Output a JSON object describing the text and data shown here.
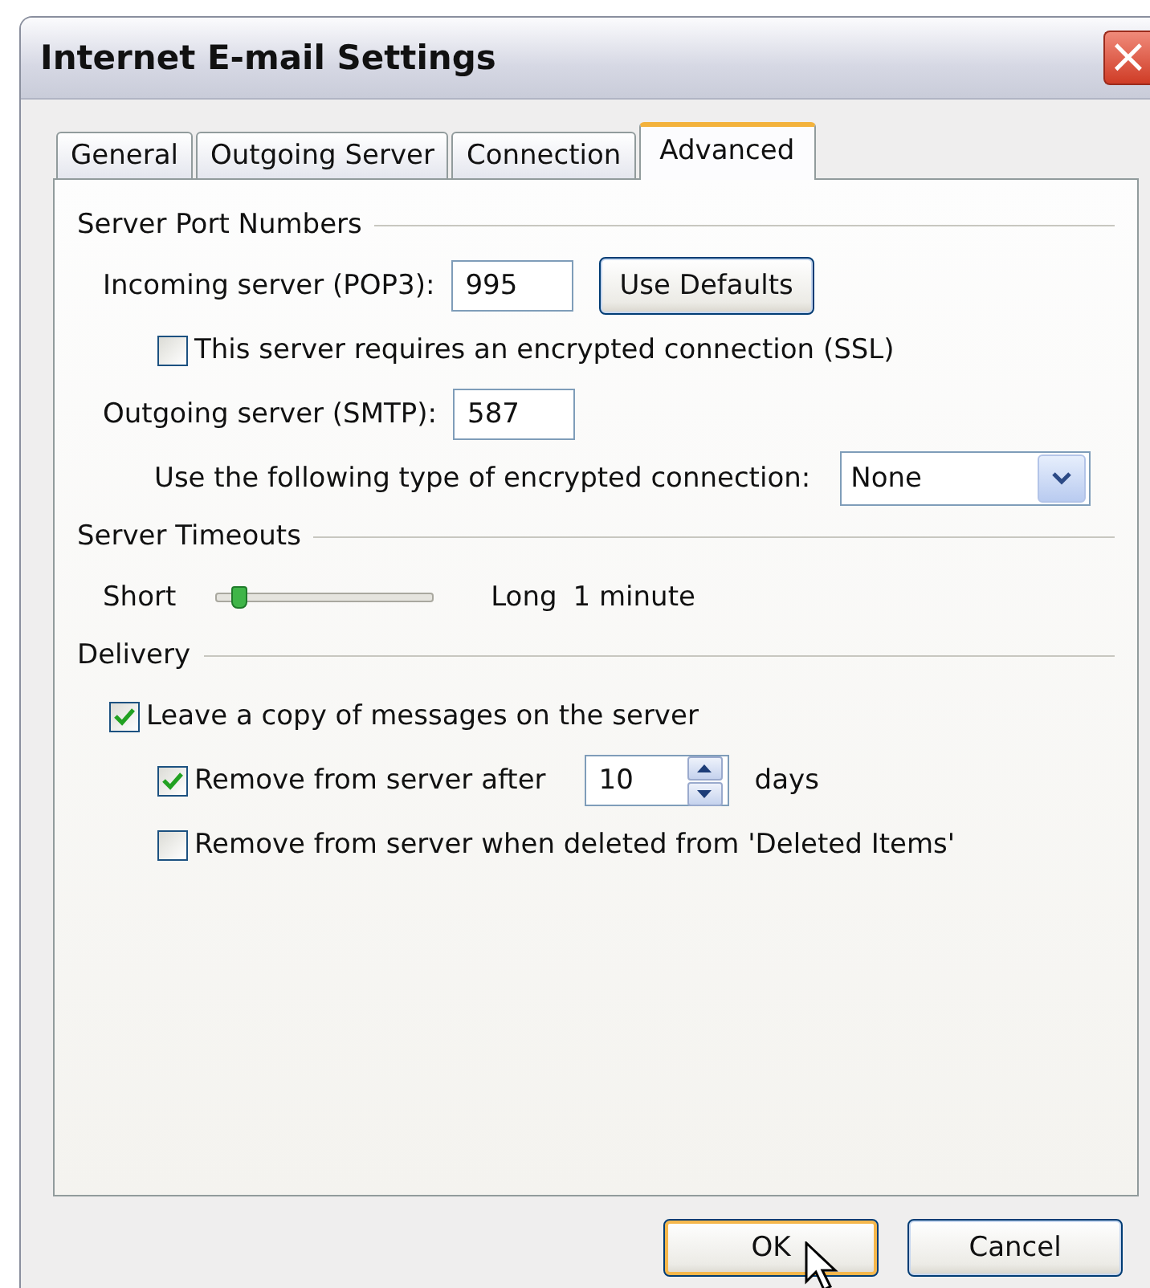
{
  "window": {
    "title": "Internet E-mail Settings",
    "close_label": "×"
  },
  "tabs": [
    {
      "label": "General",
      "selected": false
    },
    {
      "label": "Outgoing Server",
      "selected": false
    },
    {
      "label": "Connection",
      "selected": false
    },
    {
      "label": "Advanced",
      "selected": true
    }
  ],
  "server_ports": {
    "title": "Server Port Numbers",
    "incoming_label": "Incoming server (POP3):",
    "incoming_value": "995",
    "defaults_button": "Use Defaults",
    "ssl": {
      "label": "This server requires an encrypted connection (SSL)",
      "checked": false
    },
    "outgoing_label": "Outgoing server (SMTP):",
    "outgoing_value": "587",
    "encryption_label": "Use the following type of encrypted connection:",
    "encryption_value": "None"
  },
  "timeouts": {
    "title": "Server Timeouts",
    "short_label": "Short",
    "level": 0.1,
    "long_label": "Long",
    "reading": "1 minute"
  },
  "delivery": {
    "title": "Delivery",
    "options": [
      {
        "label": "Leave a copy of messages on the server",
        "checked": true,
        "children": [
          {
            "label": "Remove from server after",
            "checked": true,
            "value": "10",
            "unit": "days"
          },
          {
            "label": "Remove from server when deleted from 'Deleted Items'",
            "checked": false
          }
        ]
      }
    ]
  },
  "buttons": [
    {
      "label": "OK",
      "selected": true
    },
    {
      "label": "Cancel",
      "selected": false
    }
  ]
}
